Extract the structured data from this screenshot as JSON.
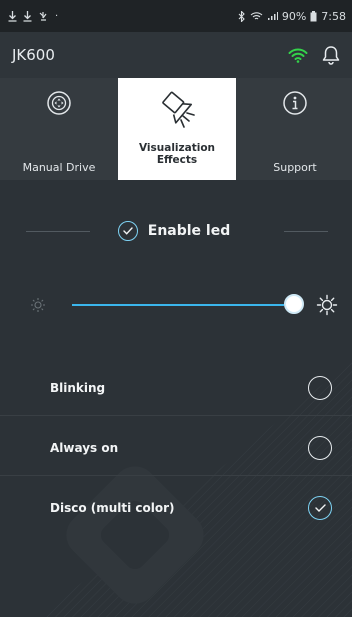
{
  "status_bar": {
    "left_icons": [
      "download-icon",
      "download-icon",
      "notification-icon",
      "dot-icon"
    ],
    "battery": "90%",
    "time": "7:58"
  },
  "app_bar": {
    "title": "JK600",
    "wifi_color": "#34d34a"
  },
  "tabs": [
    {
      "label": "Manual Drive",
      "icon": "gamepad-icon",
      "active": false
    },
    {
      "label": "Visualization Effects",
      "icon": "spotlight-icon",
      "active": true
    },
    {
      "label": "Support",
      "icon": "info-icon",
      "active": false
    }
  ],
  "led": {
    "label": "Enable led",
    "enabled": true
  },
  "brightness": {
    "value_fraction": 1.0,
    "accent": "#3bb6ec"
  },
  "modes": [
    {
      "label": "Blinking",
      "selected": false
    },
    {
      "label": "Always on",
      "selected": false
    },
    {
      "label": "Disco (multi color)",
      "selected": true
    }
  ]
}
